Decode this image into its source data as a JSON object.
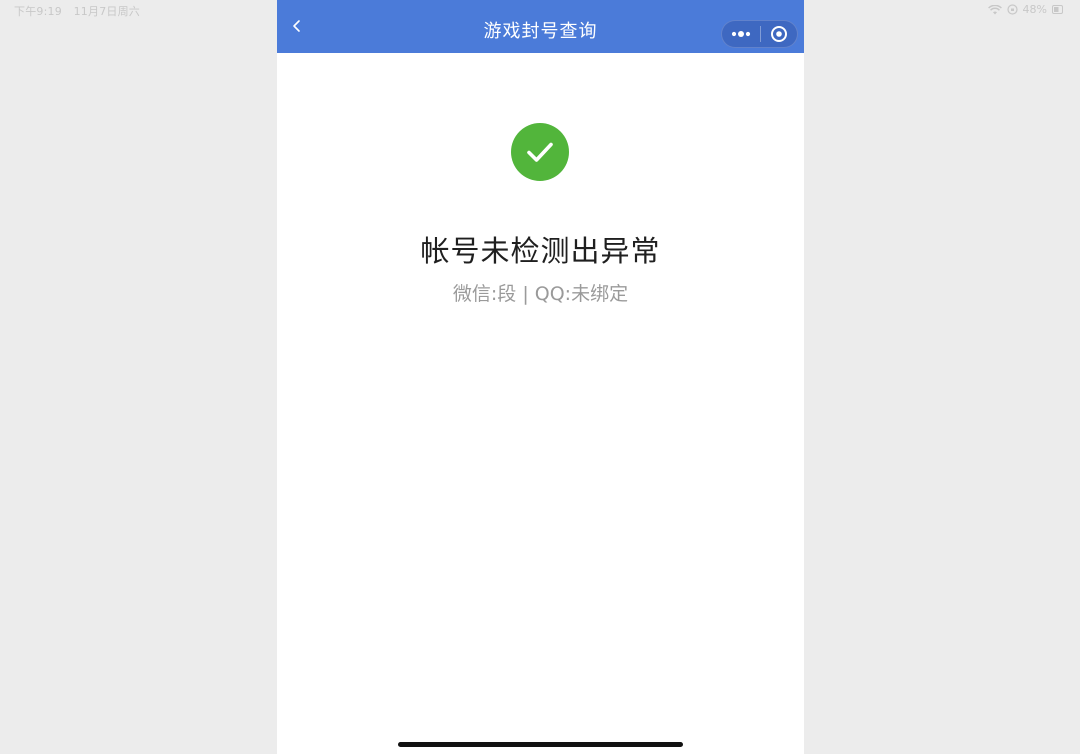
{
  "status_bar": {
    "time": "下午9:19",
    "date": "11月7日周六",
    "battery": "48%"
  },
  "navbar": {
    "title": "游戏封号查询",
    "background_color": "#4b7bd9"
  },
  "result": {
    "icon": "success-check-icon",
    "icon_color": "#52b53b",
    "title": "帐号未检测出异常",
    "description": "微信:段 | QQ:未绑定"
  }
}
